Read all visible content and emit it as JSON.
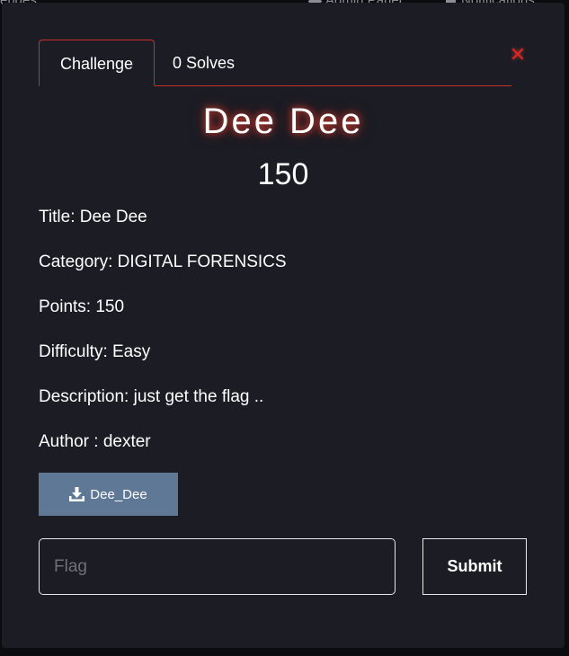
{
  "background_nav": {
    "left_text": "enges",
    "admin_label": "Admin Panel",
    "notifications_label": "Notifications"
  },
  "tabs": [
    {
      "label": "Challenge",
      "active": true
    },
    {
      "label": "0 Solves",
      "active": false
    }
  ],
  "close_label": "✕",
  "challenge": {
    "name": "Dee Dee",
    "value": "150",
    "details": [
      "Title: Dee Dee",
      "Category: DIGITAL FORENSICS",
      "Points: 150",
      "Difficulty: Easy",
      "Description: just get the flag ..",
      "Author : dexter"
    ]
  },
  "file": {
    "label": "Dee_Dee",
    "icon": "download-icon"
  },
  "flag_input": {
    "placeholder": "Flag",
    "value": ""
  },
  "submit_label": "Submit",
  "colors": {
    "modal_bg": "#1b1c24",
    "accent_red": "#c9302c",
    "file_button": "#5f7896"
  }
}
